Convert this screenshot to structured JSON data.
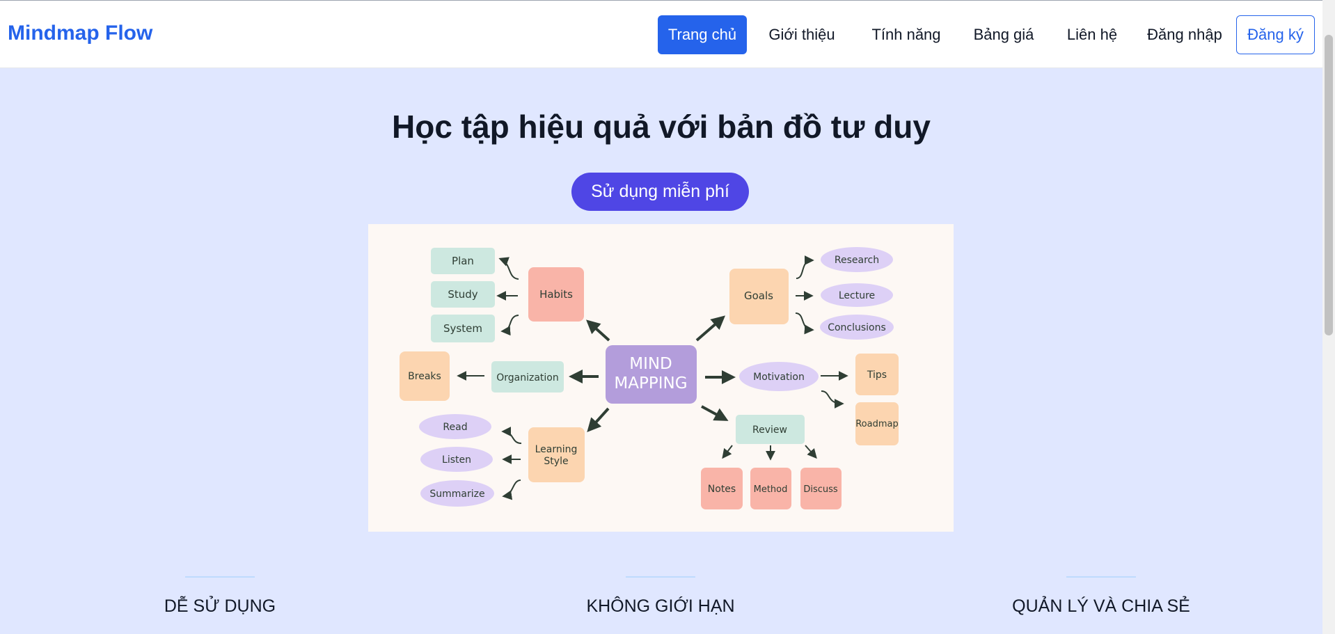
{
  "header": {
    "brand": "Mindmap Flow",
    "nav": [
      {
        "label": "Trang chủ",
        "active": true
      },
      {
        "label": "Giới thiệu"
      },
      {
        "label": "Tính năng"
      },
      {
        "label": "Bảng giá"
      },
      {
        "label": "Liên hệ"
      },
      {
        "label": "Đăng nhập"
      },
      {
        "label": "Đăng ký",
        "outlined": true
      }
    ]
  },
  "hero": {
    "title": "Học tập hiệu quả với bản đồ tư duy",
    "cta_label": "Sử dụng miễn phí"
  },
  "mindmap": {
    "center": [
      "MIND",
      "MAPPING"
    ],
    "habits": "Habits",
    "plan": "Plan",
    "study": "Study",
    "system": "System",
    "goals": "Goals",
    "research": "Research",
    "lecture": "Lecture",
    "conclusions": "Conclusions",
    "organization": "Organization",
    "breaks": "Breaks",
    "motivation": "Motivation",
    "tips": "Tips",
    "roadmap": "Roadmap",
    "learning_style": [
      "Learning",
      "Style"
    ],
    "read": "Read",
    "listen": "Listen",
    "summarize": "Summarize",
    "review": "Review",
    "notes": "Notes",
    "method": "Method",
    "discuss": "Discuss"
  },
  "features": [
    {
      "label": "DỄ SỬ DỤNG"
    },
    {
      "label": "KHÔNG GIỚI HẠN"
    },
    {
      "label": "QUẢN LÝ VÀ CHIA SẺ"
    }
  ],
  "colors": {
    "brand": "#2563eb",
    "cta": "#4f46e5",
    "hero_bg": "#e0e7ff",
    "pink_node": "#f9b4a8",
    "peach_node": "#fcd5b0",
    "mint_node": "#cde8e0",
    "lavender_node": "#ddd0f6",
    "center_node": "#b39ddb"
  }
}
